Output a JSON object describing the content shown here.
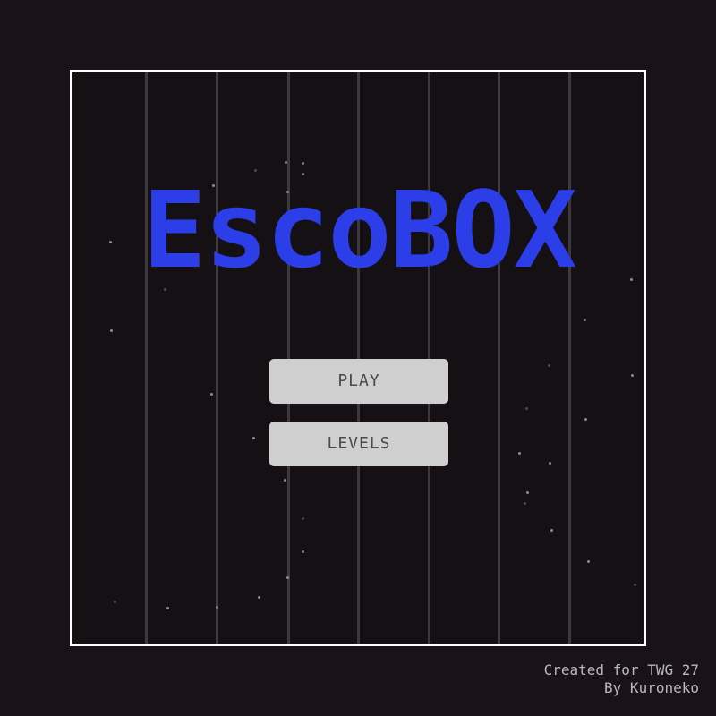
{
  "game": {
    "title": "EscoBOX",
    "title_color": "#2b3ee8",
    "menu": {
      "play_label": "PLAY",
      "levels_label": "LEVELS"
    },
    "credits": {
      "line1": "Created for TWG 27",
      "line2": "By Kuroneko"
    },
    "colors": {
      "background": "#191319",
      "frame_border": "#ffffff",
      "button_bg": "#cfcfcf",
      "button_text": "#4a4a4a",
      "bars": "#3d383d",
      "credits_text": "#b9b9b9"
    }
  }
}
